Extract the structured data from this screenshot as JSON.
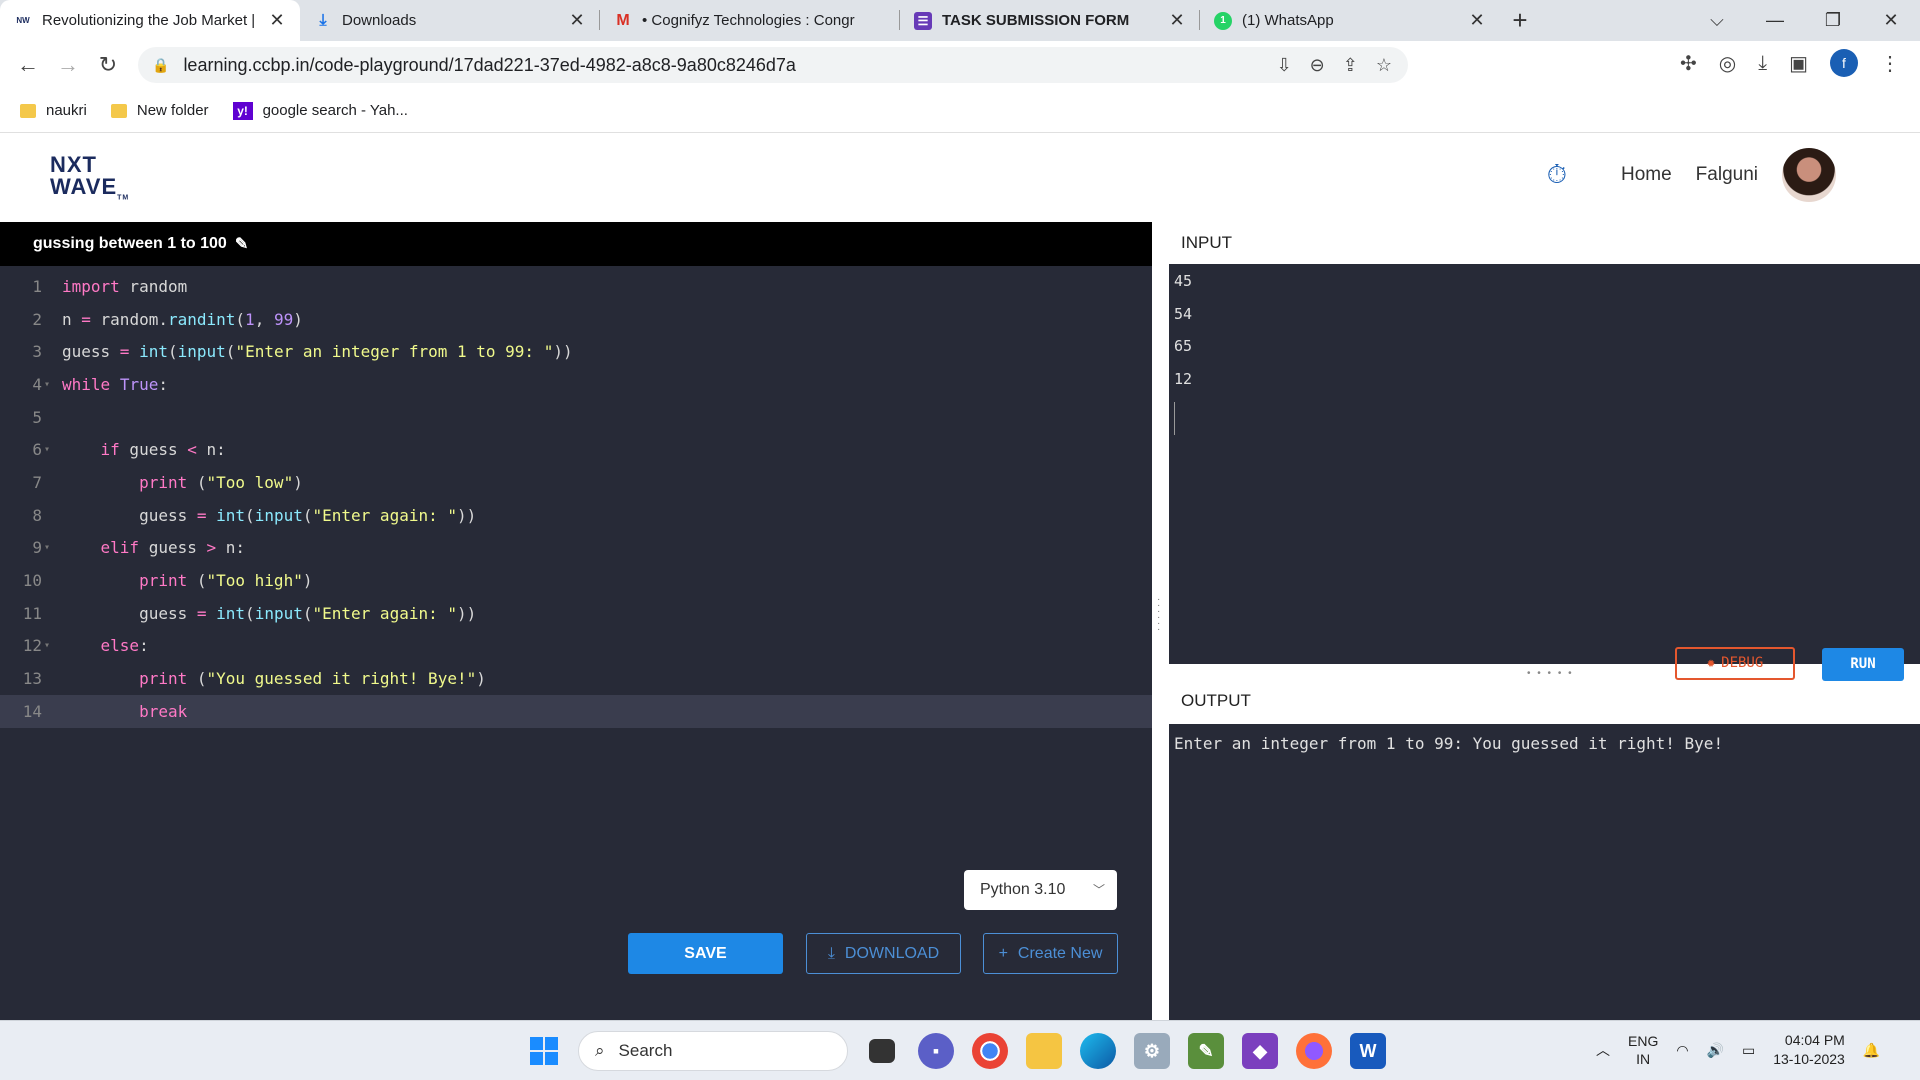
{
  "browser": {
    "tabs": [
      {
        "title": "Revolutionizing the Job Market |",
        "favicon": "nxtwave-favicon",
        "active": true
      },
      {
        "title": "Downloads",
        "favicon": "download-icon",
        "active": false
      },
      {
        "title": "• Cognifyz Technologies : Congr",
        "favicon": "gmail-icon",
        "active": false
      },
      {
        "title": "TASK SUBMISSION FORM",
        "favicon": "forms-icon",
        "active": false
      },
      {
        "title": "(1) WhatsApp",
        "favicon": "whatsapp-icon",
        "active": false
      }
    ],
    "url": "learning.ccbp.in/code-playground/17dad221-37ed-4982-a8c8-9a80c8246d7a",
    "profile_initial": "f",
    "bookmarks": [
      {
        "label": "naukri",
        "icon": "folder-icon"
      },
      {
        "label": "New folder",
        "icon": "folder-icon"
      },
      {
        "label": "google search - Yah...",
        "icon": "yahoo-icon"
      }
    ]
  },
  "app": {
    "logo_line1": "NXT",
    "logo_line2": "WAVE",
    "logo_tm": "TM",
    "nav_home": "Home",
    "user_name": "Falguni"
  },
  "editor": {
    "title": "gussing between 1 to 100",
    "language": "Python 3.10",
    "save_label": "SAVE",
    "download_label": "DOWNLOAD",
    "create_label": "Create New",
    "lines": [
      "import random",
      "n = random.randint(1, 99)",
      "guess = int(input(\"Enter an integer from 1 to 99: \"))",
      "while True:",
      "",
      "    if guess < n:",
      "        print (\"Too low\")",
      "        guess = int(input(\"Enter again: \"))",
      "    elif guess > n:",
      "        print (\"Too high\")",
      "        guess = int(input(\"Enter again: \"))",
      "    else:",
      "        print (\"You guessed it right! Bye!\")",
      "        break"
    ],
    "current_line": 14,
    "fold_lines": [
      4,
      6,
      9,
      12
    ]
  },
  "input_panel": {
    "title": "INPUT",
    "values": [
      "45",
      "54",
      "65",
      "12"
    ],
    "debug_label": "DEBUG",
    "run_label": "RUN"
  },
  "output_panel": {
    "title": "OUTPUT",
    "text": "Enter an integer from 1 to 99: You guessed it right! Bye!"
  },
  "taskbar": {
    "search_placeholder": "Search",
    "lang_line1": "ENG",
    "lang_line2": "IN",
    "time": "04:04 PM",
    "date": "13-10-2023"
  },
  "colors": {
    "editor_bg": "#272a37",
    "accent_blue": "#1e88e5",
    "debug_orange": "#e4572e"
  }
}
